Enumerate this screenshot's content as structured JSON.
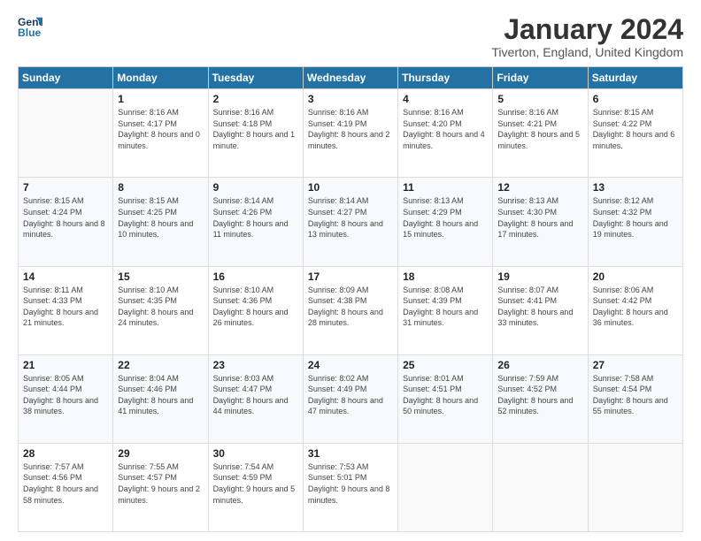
{
  "header": {
    "logo_line1": "General",
    "logo_line2": "Blue",
    "month_title": "January 2024",
    "location": "Tiverton, England, United Kingdom"
  },
  "calendar": {
    "headers": [
      "Sunday",
      "Monday",
      "Tuesday",
      "Wednesday",
      "Thursday",
      "Friday",
      "Saturday"
    ],
    "weeks": [
      [
        {
          "day": "",
          "sunrise": "",
          "sunset": "",
          "daylight": "",
          "empty": true
        },
        {
          "day": "1",
          "sunrise": "Sunrise: 8:16 AM",
          "sunset": "Sunset: 4:17 PM",
          "daylight": "Daylight: 8 hours and 0 minutes."
        },
        {
          "day": "2",
          "sunrise": "Sunrise: 8:16 AM",
          "sunset": "Sunset: 4:18 PM",
          "daylight": "Daylight: 8 hours and 1 minute."
        },
        {
          "day": "3",
          "sunrise": "Sunrise: 8:16 AM",
          "sunset": "Sunset: 4:19 PM",
          "daylight": "Daylight: 8 hours and 2 minutes."
        },
        {
          "day": "4",
          "sunrise": "Sunrise: 8:16 AM",
          "sunset": "Sunset: 4:20 PM",
          "daylight": "Daylight: 8 hours and 4 minutes."
        },
        {
          "day": "5",
          "sunrise": "Sunrise: 8:16 AM",
          "sunset": "Sunset: 4:21 PM",
          "daylight": "Daylight: 8 hours and 5 minutes."
        },
        {
          "day": "6",
          "sunrise": "Sunrise: 8:15 AM",
          "sunset": "Sunset: 4:22 PM",
          "daylight": "Daylight: 8 hours and 6 minutes."
        }
      ],
      [
        {
          "day": "7",
          "sunrise": "Sunrise: 8:15 AM",
          "sunset": "Sunset: 4:24 PM",
          "daylight": "Daylight: 8 hours and 8 minutes."
        },
        {
          "day": "8",
          "sunrise": "Sunrise: 8:15 AM",
          "sunset": "Sunset: 4:25 PM",
          "daylight": "Daylight: 8 hours and 10 minutes."
        },
        {
          "day": "9",
          "sunrise": "Sunrise: 8:14 AM",
          "sunset": "Sunset: 4:26 PM",
          "daylight": "Daylight: 8 hours and 11 minutes."
        },
        {
          "day": "10",
          "sunrise": "Sunrise: 8:14 AM",
          "sunset": "Sunset: 4:27 PM",
          "daylight": "Daylight: 8 hours and 13 minutes."
        },
        {
          "day": "11",
          "sunrise": "Sunrise: 8:13 AM",
          "sunset": "Sunset: 4:29 PM",
          "daylight": "Daylight: 8 hours and 15 minutes."
        },
        {
          "day": "12",
          "sunrise": "Sunrise: 8:13 AM",
          "sunset": "Sunset: 4:30 PM",
          "daylight": "Daylight: 8 hours and 17 minutes."
        },
        {
          "day": "13",
          "sunrise": "Sunrise: 8:12 AM",
          "sunset": "Sunset: 4:32 PM",
          "daylight": "Daylight: 8 hours and 19 minutes."
        }
      ],
      [
        {
          "day": "14",
          "sunrise": "Sunrise: 8:11 AM",
          "sunset": "Sunset: 4:33 PM",
          "daylight": "Daylight: 8 hours and 21 minutes."
        },
        {
          "day": "15",
          "sunrise": "Sunrise: 8:10 AM",
          "sunset": "Sunset: 4:35 PM",
          "daylight": "Daylight: 8 hours and 24 minutes."
        },
        {
          "day": "16",
          "sunrise": "Sunrise: 8:10 AM",
          "sunset": "Sunset: 4:36 PM",
          "daylight": "Daylight: 8 hours and 26 minutes."
        },
        {
          "day": "17",
          "sunrise": "Sunrise: 8:09 AM",
          "sunset": "Sunset: 4:38 PM",
          "daylight": "Daylight: 8 hours and 28 minutes."
        },
        {
          "day": "18",
          "sunrise": "Sunrise: 8:08 AM",
          "sunset": "Sunset: 4:39 PM",
          "daylight": "Daylight: 8 hours and 31 minutes."
        },
        {
          "day": "19",
          "sunrise": "Sunrise: 8:07 AM",
          "sunset": "Sunset: 4:41 PM",
          "daylight": "Daylight: 8 hours and 33 minutes."
        },
        {
          "day": "20",
          "sunrise": "Sunrise: 8:06 AM",
          "sunset": "Sunset: 4:42 PM",
          "daylight": "Daylight: 8 hours and 36 minutes."
        }
      ],
      [
        {
          "day": "21",
          "sunrise": "Sunrise: 8:05 AM",
          "sunset": "Sunset: 4:44 PM",
          "daylight": "Daylight: 8 hours and 38 minutes."
        },
        {
          "day": "22",
          "sunrise": "Sunrise: 8:04 AM",
          "sunset": "Sunset: 4:46 PM",
          "daylight": "Daylight: 8 hours and 41 minutes."
        },
        {
          "day": "23",
          "sunrise": "Sunrise: 8:03 AM",
          "sunset": "Sunset: 4:47 PM",
          "daylight": "Daylight: 8 hours and 44 minutes."
        },
        {
          "day": "24",
          "sunrise": "Sunrise: 8:02 AM",
          "sunset": "Sunset: 4:49 PM",
          "daylight": "Daylight: 8 hours and 47 minutes."
        },
        {
          "day": "25",
          "sunrise": "Sunrise: 8:01 AM",
          "sunset": "Sunset: 4:51 PM",
          "daylight": "Daylight: 8 hours and 50 minutes."
        },
        {
          "day": "26",
          "sunrise": "Sunrise: 7:59 AM",
          "sunset": "Sunset: 4:52 PM",
          "daylight": "Daylight: 8 hours and 52 minutes."
        },
        {
          "day": "27",
          "sunrise": "Sunrise: 7:58 AM",
          "sunset": "Sunset: 4:54 PM",
          "daylight": "Daylight: 8 hours and 55 minutes."
        }
      ],
      [
        {
          "day": "28",
          "sunrise": "Sunrise: 7:57 AM",
          "sunset": "Sunset: 4:56 PM",
          "daylight": "Daylight: 8 hours and 58 minutes."
        },
        {
          "day": "29",
          "sunrise": "Sunrise: 7:55 AM",
          "sunset": "Sunset: 4:57 PM",
          "daylight": "Daylight: 9 hours and 2 minutes."
        },
        {
          "day": "30",
          "sunrise": "Sunrise: 7:54 AM",
          "sunset": "Sunset: 4:59 PM",
          "daylight": "Daylight: 9 hours and 5 minutes."
        },
        {
          "day": "31",
          "sunrise": "Sunrise: 7:53 AM",
          "sunset": "Sunset: 5:01 PM",
          "daylight": "Daylight: 9 hours and 8 minutes."
        },
        {
          "day": "",
          "sunrise": "",
          "sunset": "",
          "daylight": "",
          "empty": true
        },
        {
          "day": "",
          "sunrise": "",
          "sunset": "",
          "daylight": "",
          "empty": true
        },
        {
          "day": "",
          "sunrise": "",
          "sunset": "",
          "daylight": "",
          "empty": true
        }
      ]
    ]
  }
}
